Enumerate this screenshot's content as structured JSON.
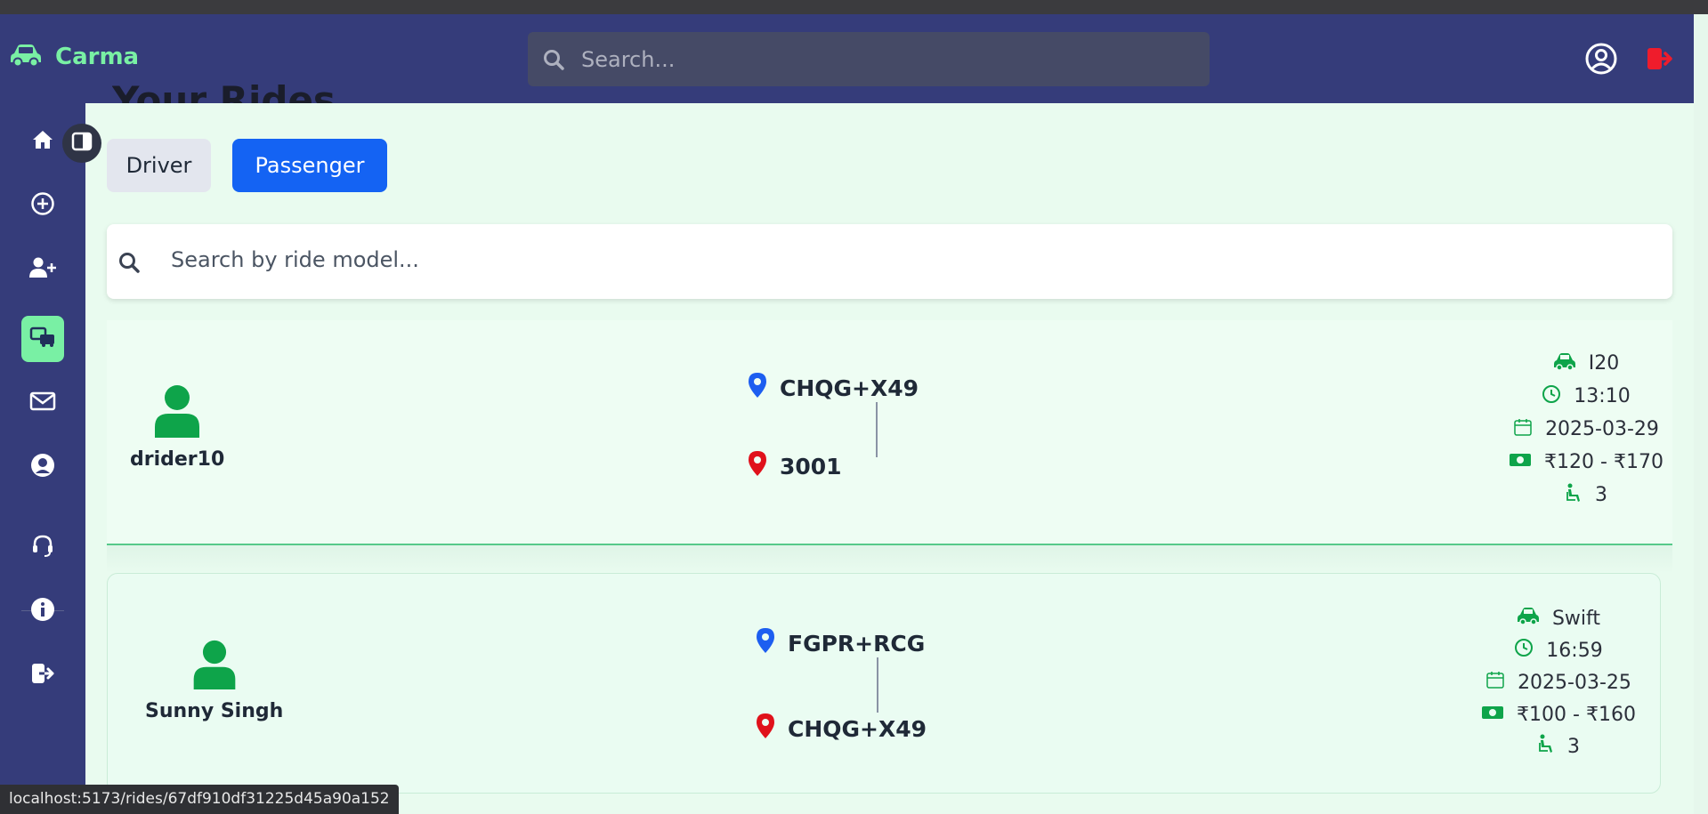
{
  "app": {
    "name": "Carma"
  },
  "navbar": {
    "search_placeholder": "Search...",
    "icons": [
      "car-icon",
      "search-icon",
      "user-circle-icon",
      "logout-icon"
    ]
  },
  "page": {
    "heading": "Your Rides"
  },
  "sidebar": {
    "items": [
      {
        "name": "home",
        "icon": "home-icon",
        "active": false
      },
      {
        "name": "create-ride",
        "icon": "plus-circle-icon",
        "active": false
      },
      {
        "name": "add-user",
        "icon": "user-plus-icon",
        "active": false
      },
      {
        "name": "rides",
        "icon": "cars-icon",
        "active": true
      },
      {
        "name": "messages",
        "icon": "mail-icon",
        "active": false
      },
      {
        "name": "profile",
        "icon": "user-icon",
        "active": false
      },
      {
        "name": "support",
        "icon": "headset-icon",
        "active": false
      },
      {
        "name": "about",
        "icon": "info-icon",
        "active": false
      },
      {
        "name": "logout",
        "icon": "logout-icon",
        "active": false
      }
    ]
  },
  "tabs": {
    "driver": "Driver",
    "passenger": "Passenger",
    "selected": "Passenger"
  },
  "ride_search": {
    "placeholder": "Search by ride model..."
  },
  "rides": [
    {
      "user": "drider10",
      "from": "CHQG+X49",
      "to": "3001",
      "model": "I20",
      "time": "13:10",
      "date": "2025-03-29",
      "price": "₹120 - ₹170",
      "seats": "3"
    },
    {
      "user": "Sunny Singh",
      "from": "FGPR+RCG",
      "to": "CHQG+X49",
      "model": "Swift",
      "time": "16:59",
      "date": "2025-03-25",
      "price": "₹100 - ₹160",
      "seats": "3"
    }
  ],
  "statusbar": {
    "url": "localhost:5173/rides/67df910df31225d45a90a152"
  },
  "colors": {
    "navbar": "#353c7a",
    "brand_green": "#79f0a4",
    "accent_blue": "#1463f3",
    "pin_blue": "#1d5ef0",
    "pin_red": "#e0111b",
    "detail_green": "#0ea44a",
    "logout_red": "#ef1c2c"
  }
}
